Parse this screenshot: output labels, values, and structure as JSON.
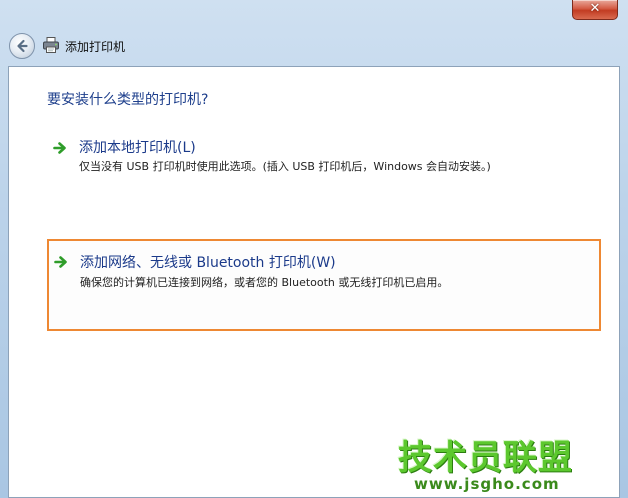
{
  "window": {
    "title": "添加打印机",
    "close_glyph": "✕"
  },
  "nav": {
    "back_icon": "back-arrow-icon",
    "app_icon": "printer-icon"
  },
  "main": {
    "question": "要安装什么类型的打印机?",
    "options": [
      {
        "title": "添加本地打印机(L)",
        "description": "仅当没有 USB 打印机时使用此选项。(插入 USB 打印机后，Windows 会自动安装。)",
        "icon": "green-arrow-icon",
        "selected": false
      },
      {
        "title": "添加网络、无线或 Bluetooth 打印机(W)",
        "description": "确保您的计算机已连接到网络，或者您的 Bluetooth 或无线打印机已启用。",
        "icon": "green-arrow-icon",
        "selected": true
      }
    ]
  },
  "watermark": {
    "main": "技术员联盟",
    "url": "www.jsgho.com"
  },
  "colors": {
    "accent_border": "#ee8833",
    "link_text": "#1b3a8a",
    "arrow_green": "#2f9d2a"
  }
}
